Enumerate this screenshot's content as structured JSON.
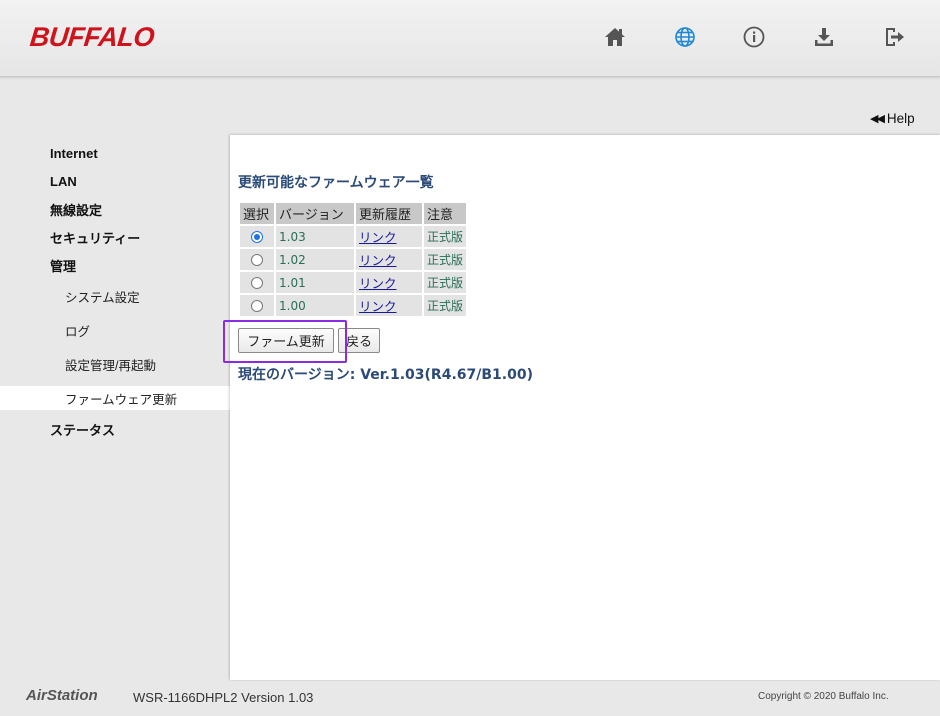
{
  "header": {
    "logo": "BUFFALO",
    "icons": [
      "home-icon",
      "globe-icon",
      "info-icon",
      "download-icon",
      "logout-icon"
    ],
    "globe_active_color": "#1e88d6"
  },
  "help": {
    "label": "Help"
  },
  "sidebar": {
    "items": [
      {
        "label": "Internet"
      },
      {
        "label": "LAN"
      },
      {
        "label": "無線設定"
      },
      {
        "label": "セキュリティー"
      },
      {
        "label": "管理"
      },
      {
        "label": "システム設定"
      },
      {
        "label": "ログ"
      },
      {
        "label": "設定管理/再起動"
      },
      {
        "label": "ファームウェア更新"
      },
      {
        "label": "ステータス"
      }
    ]
  },
  "main": {
    "title": "更新可能なファームウェア一覧",
    "table": {
      "headers": [
        "選択",
        "バージョン",
        "更新履歴",
        "注意"
      ],
      "rows": [
        {
          "selected": true,
          "version": "1.03",
          "link": "リンク",
          "note": "正式版"
        },
        {
          "selected": false,
          "version": "1.02",
          "link": "リンク",
          "note": "正式版"
        },
        {
          "selected": false,
          "version": "1.01",
          "link": "リンク",
          "note": "正式版"
        },
        {
          "selected": false,
          "version": "1.00",
          "link": "リンク",
          "note": "正式版"
        }
      ]
    },
    "buttons": {
      "update": "ファーム更新",
      "back": "戻る"
    },
    "current_version": "現在のバージョン: Ver.1.03(R4.67/B1.00)"
  },
  "footer": {
    "brand": "AirStation",
    "model": "WSR-1166DHPL2 Version 1.03",
    "copyright": "Copyright © 2020 Buffalo Inc."
  }
}
